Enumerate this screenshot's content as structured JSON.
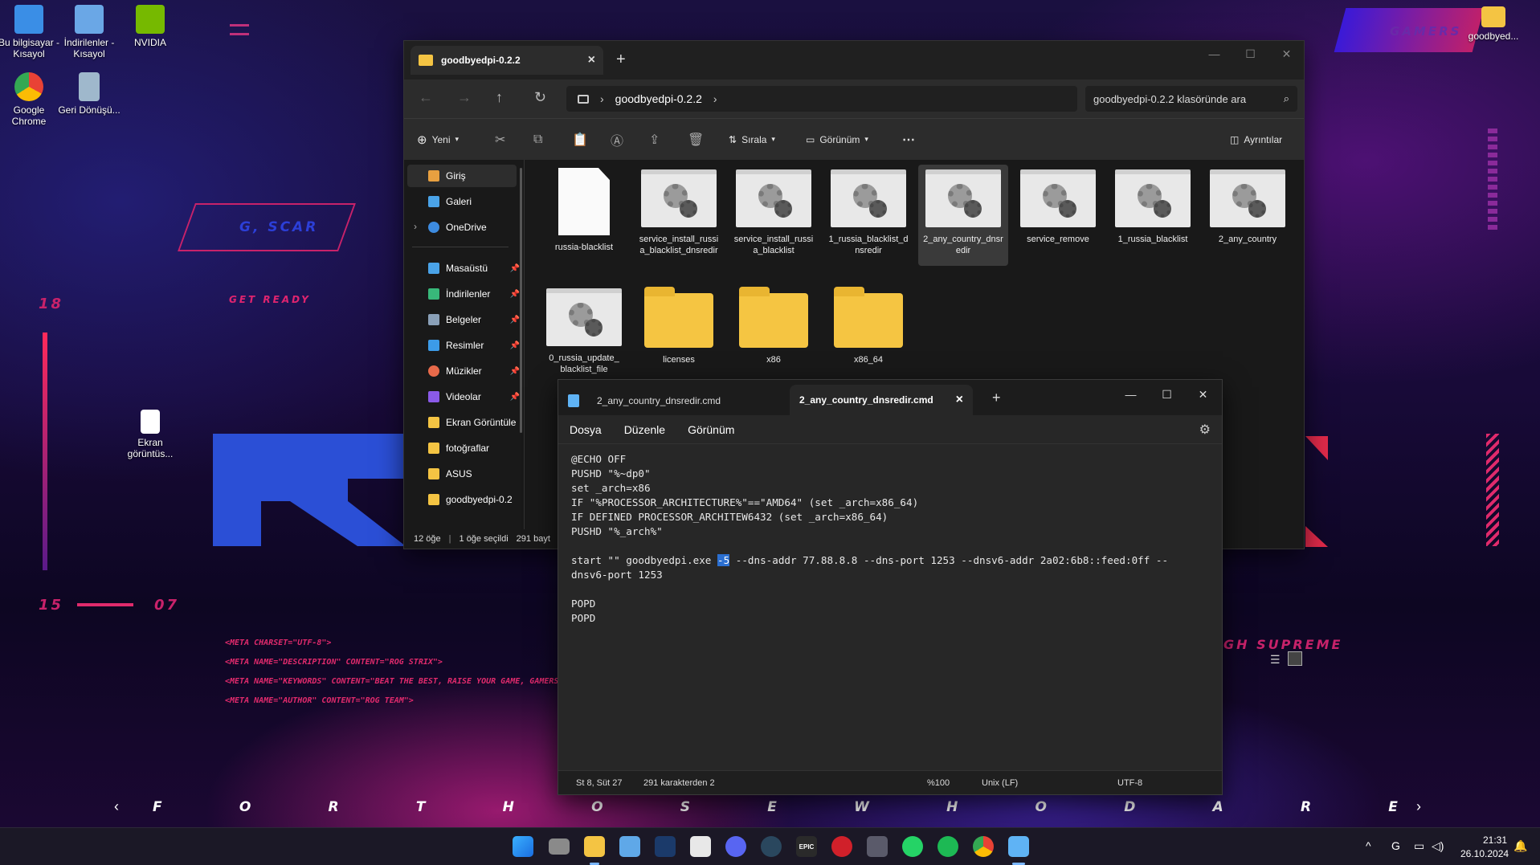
{
  "desktop": {
    "icons": [
      {
        "label": "Bu bilgisayar - Kısayol",
        "color": "#3a8ee6"
      },
      {
        "label": "İndirilenler - Kısayol",
        "color": "#6aa7e6"
      },
      {
        "label": "NVIDIA",
        "color": "#76b900"
      },
      {
        "label": "Google Chrome",
        "color": "#e94235"
      },
      {
        "label": "Geri Dönüşü...",
        "color": "#9fb8cc"
      },
      {
        "label": "Ekran görüntüs...",
        "color": "#ffffff"
      },
      {
        "label": "goodbyed...",
        "color": "#f4c443"
      }
    ]
  },
  "wallpaper": {
    "scar": "G, SCAR",
    "get_ready": "GET READY",
    "num18": "18",
    "num15": "15",
    "num07": "07",
    "gamers": "GAMERS",
    "supreme": "GH SUPREME",
    "code_lines": [
      "<META CHARSET=\"UTF-8\">",
      "<META NAME=\"DESCRIPTION\" CONTENT=\"ROG STRIX\">",
      "<META NAME=\"KEYWORDS\" CONTENT=\"BEAT THE BEST, RAISE YOUR GAME, GAMERS, STRIX\">",
      "<META NAME=\"AUTHOR\" CONTENT=\"ROG TEAM\">"
    ],
    "bottom_letters": [
      "F",
      "O",
      "R",
      "T",
      "H",
      "O",
      "S",
      "E",
      "W",
      "H",
      "O",
      "D",
      "A",
      "R",
      "E"
    ]
  },
  "explorer": {
    "tab_title": "goodbyedpi-0.2.2",
    "breadcrumb": "goodbyedpi-0.2.2",
    "search_placeholder": "goodbyedpi-0.2.2 klasöründe ara",
    "toolbar": {
      "new": "Yeni",
      "sort": "Sırala",
      "view": "Görünüm",
      "details": "Ayrıntılar"
    },
    "sidebar": [
      {
        "label": "Giriş",
        "color": "#e8a040",
        "pinned": false
      },
      {
        "label": "Galeri",
        "color": "#4aa3e8",
        "pinned": false
      },
      {
        "label": "OneDrive",
        "color": "#3d8be0",
        "pinned": false
      },
      {
        "label": "Masaüstü",
        "color": "#4aa3e8",
        "pinned": true
      },
      {
        "label": "İndirilenler",
        "color": "#38b87a",
        "pinned": true
      },
      {
        "label": "Belgeler",
        "color": "#8aa0b8",
        "pinned": true
      },
      {
        "label": "Resimler",
        "color": "#3c9be8",
        "pinned": true
      },
      {
        "label": "Müzikler",
        "color": "#e86a4a",
        "pinned": true
      },
      {
        "label": "Videolar",
        "color": "#8a5ae8",
        "pinned": true
      },
      {
        "label": "Ekran Görüntüle",
        "color": "#f4c443",
        "pinned": false
      },
      {
        "label": "fotoğraflar",
        "color": "#f4c443",
        "pinned": false
      },
      {
        "label": "ASUS",
        "color": "#f4c443",
        "pinned": false
      },
      {
        "label": "goodbyedpi-0.2",
        "color": "#f4c443",
        "pinned": false
      }
    ],
    "files": [
      {
        "name": "russia-blacklist",
        "type": "txt"
      },
      {
        "name": "service_install_russia_blacklist_dnsredir",
        "type": "cmd"
      },
      {
        "name": "service_install_russia_blacklist",
        "type": "cmd"
      },
      {
        "name": "1_russia_blacklist_dnsredir",
        "type": "cmd"
      },
      {
        "name": "2_any_country_dnsredir",
        "type": "cmd"
      },
      {
        "name": "service_remove",
        "type": "cmd"
      },
      {
        "name": "1_russia_blacklist",
        "type": "cmd"
      },
      {
        "name": "2_any_country",
        "type": "cmd"
      },
      {
        "name": "0_russia_update_blacklist_file",
        "type": "cmd"
      },
      {
        "name": "licenses",
        "type": "folder"
      },
      {
        "name": "x86",
        "type": "folder"
      },
      {
        "name": "x86_64",
        "type": "folder"
      }
    ],
    "status": {
      "count": "12 öğe",
      "selected": "1 öğe seçildi",
      "size": "291 bayt"
    }
  },
  "notepad": {
    "tab1": "2_any_country_dnsredir.cmd",
    "tab2": "2_any_country_dnsredir.cmd",
    "menu": [
      "Dosya",
      "Düzenle",
      "Görünüm"
    ],
    "lines": [
      "@ECHO OFF",
      "PUSHD \"%~dp0\"",
      "set _arch=x86",
      "IF \"%PROCESSOR_ARCHITECTURE%\"==\"AMD64\" (set _arch=x86_64)",
      "IF DEFINED PROCESSOR_ARCHITEW6432 (set _arch=x86_64)",
      "PUSHD \"%_arch%\"",
      "",
      "start \"\" goodbyedpi.exe ",
      "dnsv6-port 1253",
      "",
      "POPD",
      "POPD"
    ],
    "highlight": "-5",
    "line8_rest": " --dns-addr 77.88.8.8 --dns-port 1253 --dnsv6-addr 2a02:6b8::feed:0ff --",
    "status": {
      "pos": "St 8, Süt 27",
      "chars": "291 karakterden 2",
      "zoom": "%100",
      "eol": "Unix (LF)",
      "enc": "UTF-8"
    }
  },
  "taskbar": {
    "time": "21:31",
    "date": "26.10.2024"
  }
}
